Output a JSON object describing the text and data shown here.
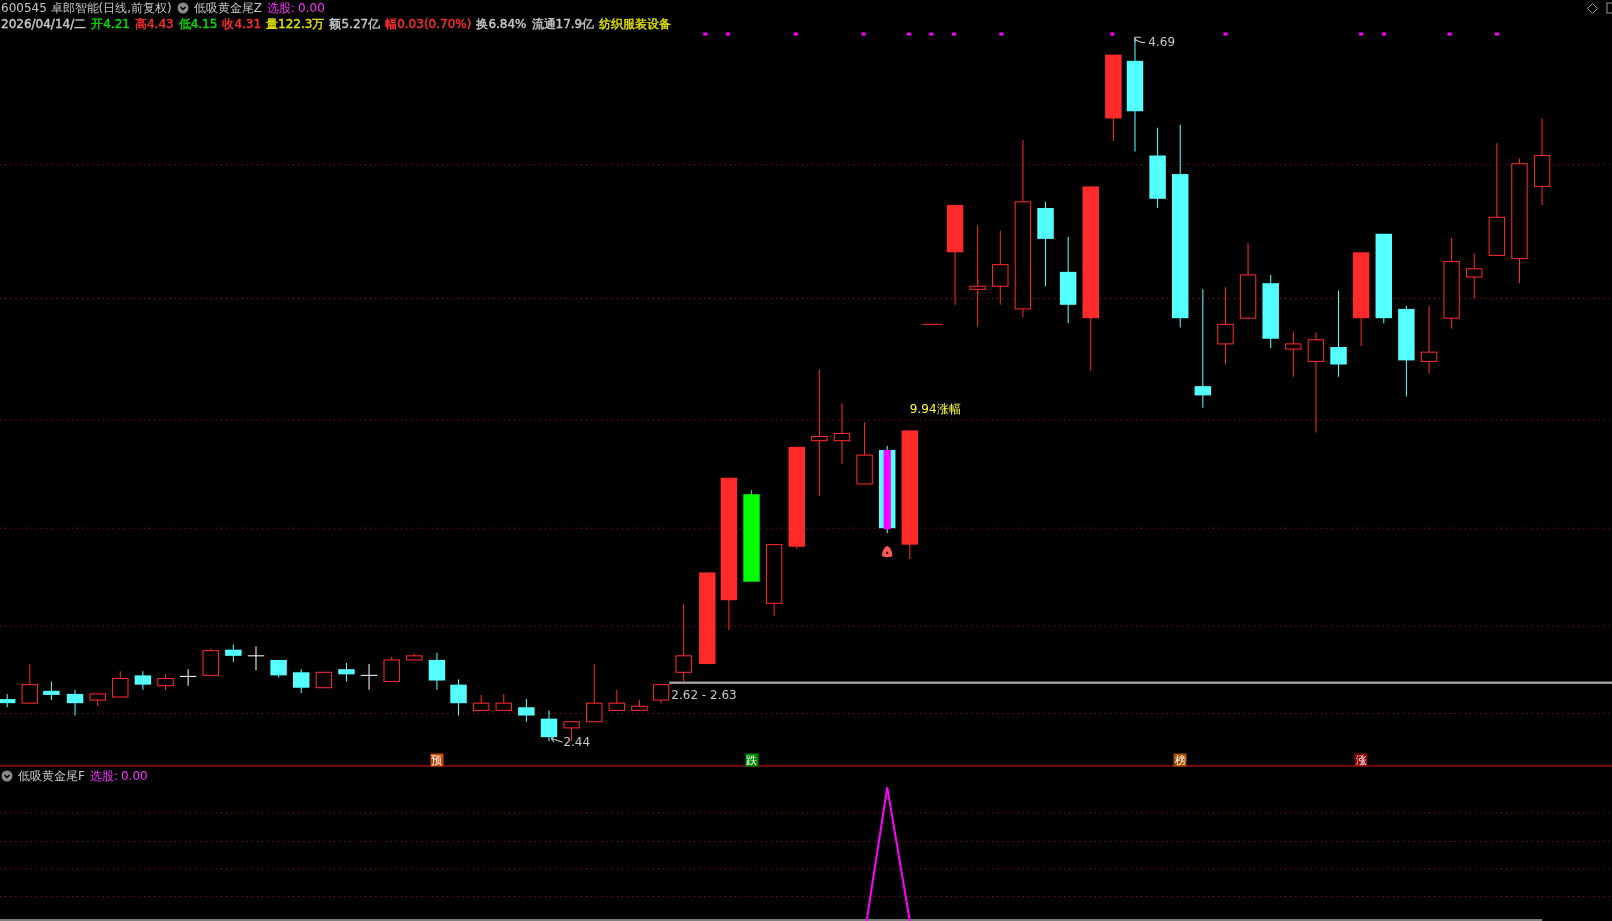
{
  "header": {
    "title": "600545 卓郎智能(日线,前复权)",
    "indicator": "低吸黄金尾Z",
    "signal_label": "选股:",
    "signal_value": "0.00"
  },
  "quote": [
    {
      "text": "2026/04/14/二",
      "color": "#c8c8c8"
    },
    {
      "text": "开4.21",
      "color": "#00e000"
    },
    {
      "text": "高4.43",
      "color": "#ff3030"
    },
    {
      "text": "低4.15",
      "color": "#00e000"
    },
    {
      "text": "收4.31",
      "color": "#ff3030"
    },
    {
      "text": "量122.3万",
      "color": "#e0e000"
    },
    {
      "text": "额5.27亿",
      "color": "#c8c8c8"
    },
    {
      "text": "幅0.03(0.70%)",
      "color": "#ff3030"
    },
    {
      "text": "换6.84%",
      "color": "#c8c8c8"
    },
    {
      "text": "流通17.9亿",
      "color": "#c8c8c8"
    },
    {
      "text": "纺织服装设备",
      "color": "#e0e000"
    }
  ],
  "chart_labels": [
    {
      "text": "4.69",
      "kind": "high"
    },
    {
      "text": "9.94涨幅",
      "kind": "signal"
    },
    {
      "text": "2.62 - 2.63",
      "kind": "range"
    },
    {
      "text": "2.44",
      "kind": "low"
    }
  ],
  "markers": [
    {
      "text": "预",
      "color": "#c84800"
    },
    {
      "text": "跌",
      "color": "#008a00"
    },
    {
      "text": "榜",
      "color": "#a85000"
    },
    {
      "text": "涨",
      "color": "#8a0000"
    }
  ],
  "lower_panel": {
    "title": "低吸黄金尾F",
    "signal_label": "选股:",
    "signal_value": "0.00"
  }
}
